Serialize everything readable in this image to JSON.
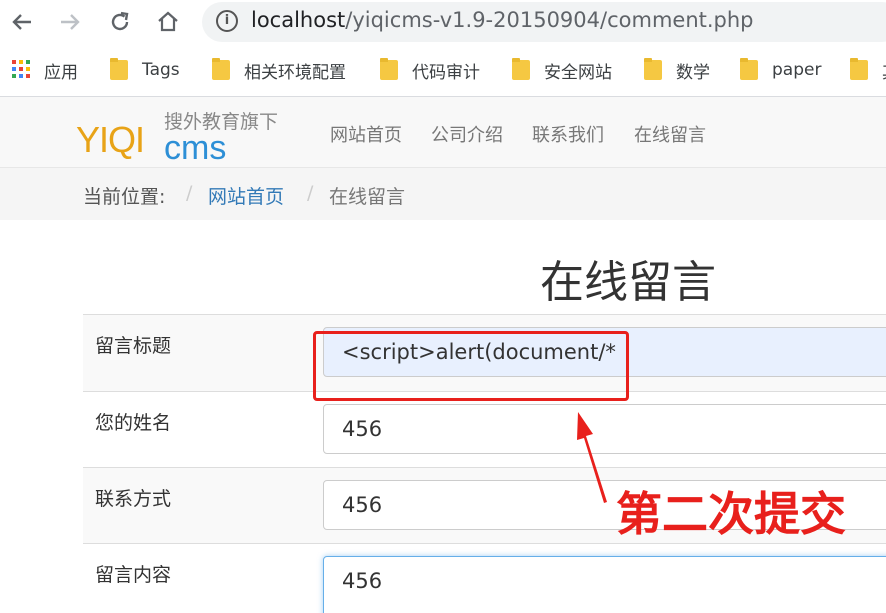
{
  "browser": {
    "url_host": "localhost",
    "url_path": "/yiqicms-v1.9-20150904/comment.php",
    "bookmarks": [
      {
        "label": "应用",
        "icon": "apps-grid-icon"
      },
      {
        "label": "Tags",
        "icon": "folder-icon"
      },
      {
        "label": "相关环境配置",
        "icon": "folder-icon"
      },
      {
        "label": "代码审计",
        "icon": "folder-icon"
      },
      {
        "label": "安全网站",
        "icon": "folder-icon"
      },
      {
        "label": "数学",
        "icon": "folder-icon"
      },
      {
        "label": "paper",
        "icon": "folder-icon"
      },
      {
        "label": "其",
        "icon": "folder-icon"
      }
    ],
    "info_icon_glyph": "i"
  },
  "site": {
    "logo_yiqi": "YIQI",
    "logo_cms": "cms",
    "logo_slogan": "搜外教育旗下",
    "nav": [
      "网站首页",
      "公司介绍",
      "联系我们",
      "在线留言"
    ]
  },
  "breadcrumb": {
    "prefix": "当前位置:",
    "sep": "/",
    "home": "网站首页",
    "current": "在线留言"
  },
  "page": {
    "title": "在线留言",
    "rows": [
      {
        "label": "留言标题",
        "value": "<script>alert(document/*"
      },
      {
        "label": "您的姓名",
        "value": "456"
      },
      {
        "label": "联系方式",
        "value": "456"
      },
      {
        "label": "留言内容",
        "value": "456"
      }
    ]
  },
  "annotation": {
    "text": "第二次提交",
    "color": "#e8201c"
  },
  "colors": {
    "link": "#337ab7",
    "logo_yellow": "#e8a317",
    "logo_blue": "#2d8fd6",
    "autofill": "#e8f0fe"
  }
}
